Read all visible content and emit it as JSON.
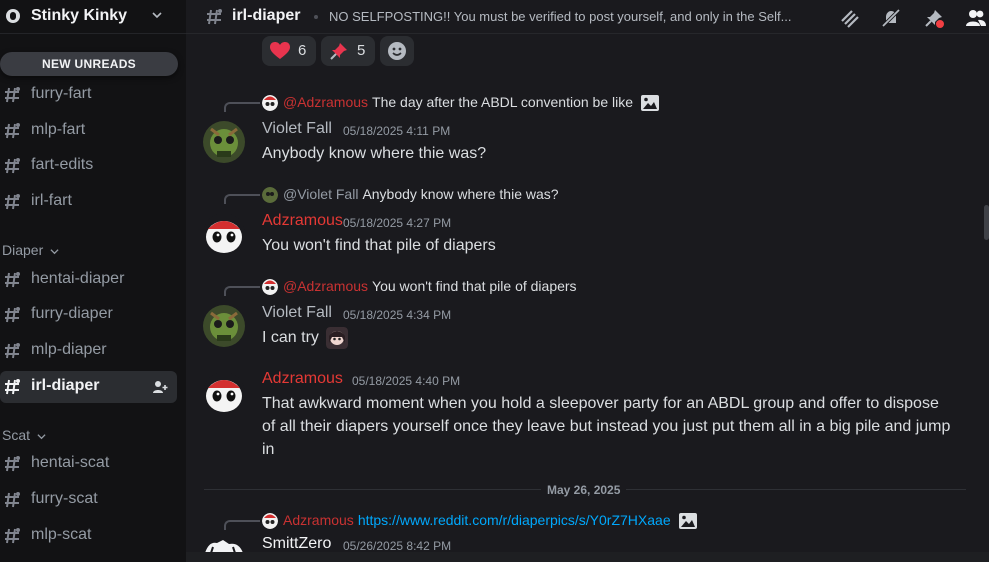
{
  "server": {
    "name": "Stinky Kinky"
  },
  "sidebar": {
    "new_unreads": "NEW UNREADS",
    "channels_top": [
      {
        "label": "furry-fart"
      },
      {
        "label": "mlp-fart"
      },
      {
        "label": "fart-edits"
      },
      {
        "label": "irl-fart"
      }
    ],
    "category_diaper": "Diaper",
    "channels_diaper": [
      {
        "label": "hentai-diaper"
      },
      {
        "label": "furry-diaper"
      },
      {
        "label": "mlp-diaper"
      },
      {
        "label": "irl-diaper"
      }
    ],
    "category_scat": "Scat",
    "channels_scat": [
      {
        "label": "hentai-scat"
      },
      {
        "label": "furry-scat"
      },
      {
        "label": "mlp-scat"
      }
    ]
  },
  "channel": {
    "name": "irl-diaper",
    "topic": "NO SELFPOSTING!! You must be verified to post yourself, and only in the Self..."
  },
  "reactions": [
    {
      "emoji": "heart",
      "count": "6"
    },
    {
      "emoji": "pushpin",
      "count": "5"
    }
  ],
  "messages": [
    {
      "reply_name": "@Adzramous",
      "reply_text": "The day after the ABDL convention be like",
      "author": "Violet Fall",
      "timestamp": "05/18/2025 4:11 PM",
      "text": "Anybody know where thie was?"
    },
    {
      "reply_name": "@Violet Fall",
      "reply_text": "Anybody know where thie was?",
      "author": "Adzramous",
      "timestamp": "05/18/2025 4:27 PM",
      "text": "You won't find that pile of diapers"
    },
    {
      "reply_name": "@Adzramous",
      "reply_text": "You won't find that pile of diapers",
      "author": "Violet Fall",
      "timestamp": "05/18/2025 4:34 PM",
      "text": "I can try"
    },
    {
      "author": "Adzramous",
      "timestamp": "05/18/2025 4:40 PM",
      "text": "That awkward moment when you hold a sleepover party for an ABDL group and offer to dispose of all their diapers yourself once they leave but instead you just put them all in a big pile and jump in"
    },
    {
      "reply_name": "Adzramous",
      "reply_link": "https://www.reddit.com/r/diaperpics/s/Y0rZ7HXaae",
      "author": "SmittZero",
      "timestamp": "05/26/2025 8:42 PM"
    }
  ],
  "date_divider": "May 26, 2025",
  "colors": {
    "accent_red": "#e53935",
    "link": "#00a8fc",
    "background": "#1a1a1e",
    "sidebar": "#121214"
  }
}
